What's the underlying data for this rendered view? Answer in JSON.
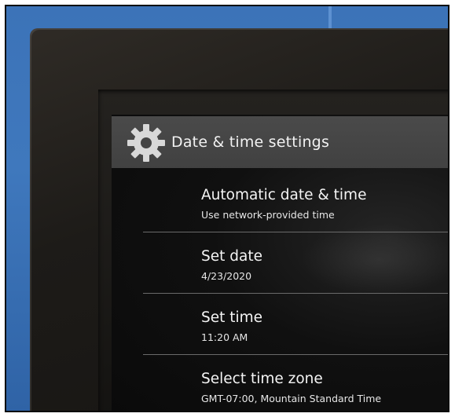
{
  "header": {
    "title": "Date & time settings",
    "icon": "gear-icon"
  },
  "settings": {
    "items": [
      {
        "label": "Automatic date & time",
        "value": "Use network-provided time"
      },
      {
        "label": "Set date",
        "value": "4/23/2020"
      },
      {
        "label": "Set time",
        "value": "11:20 AM"
      },
      {
        "label": "Select time zone",
        "value": "GMT-07:00, Mountain Standard Time"
      }
    ]
  },
  "colors": {
    "titlebar": "#444444",
    "text": "#f2f2f2",
    "divider": "#6a6a6a"
  }
}
